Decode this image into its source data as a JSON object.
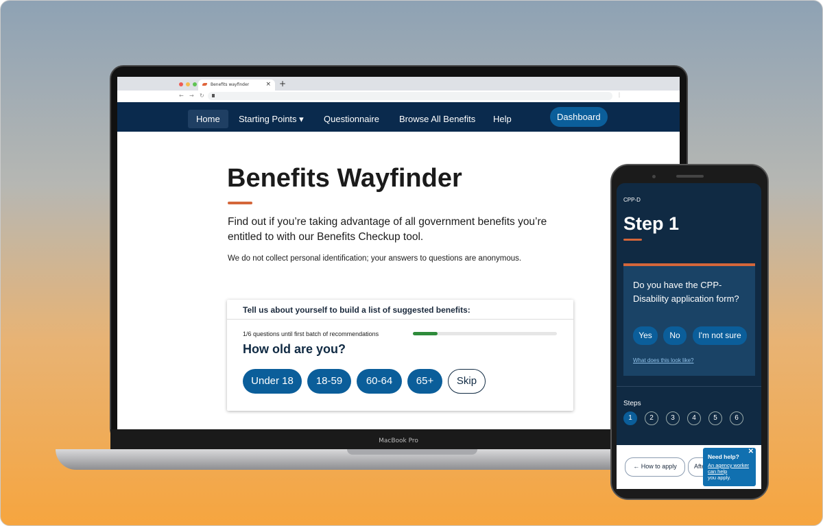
{
  "browser": {
    "tab_title": "Benefits wayfinder",
    "new_tab": "+",
    "close_tab": "×"
  },
  "nav": {
    "items": [
      "Home",
      "Starting Points",
      "Questionnaire",
      "Browse All Benefits",
      "Help"
    ],
    "dashboard": "Dashboard",
    "dropdown_caret": "▾"
  },
  "laptop_label": "MacBook Pro",
  "hero": {
    "title": "Benefits Wayfinder",
    "intro": "Find out if you’re taking advantage of all government benefits you’re entitled to with our Benefits Checkup tool.",
    "privacy": "We do not collect personal identification; your answers to questions are anonymous."
  },
  "card": {
    "header": "Tell us about yourself to build a list of suggested benefits:",
    "progress_text": "1/6 questions until first batch of recommendations",
    "progress": 0.17,
    "question": "How old are you?",
    "options": [
      "Under 18",
      "18-59",
      "60-64",
      "65+"
    ],
    "skip": "Skip"
  },
  "phone": {
    "eyebrow": "CPP-D",
    "title": "Step 1",
    "question": "Do you have the CPP-Disability application form?",
    "answers": [
      "Yes",
      "No",
      "I'm not sure"
    ],
    "help_link": "What does this look like?",
    "steps_label": "Steps",
    "steps": [
      "1",
      "2",
      "3",
      "4",
      "5",
      "6"
    ],
    "current_step": 1,
    "back_button": "How to apply",
    "next_button": "After",
    "help_title": "Need help?",
    "help_link_text": "An agency worker can help",
    "help_text": "you apply."
  },
  "colors": {
    "navy": "#0a2a4d",
    "accent": "#d4663a",
    "button": "#0b5e9a",
    "progress": "#2e8b3a"
  }
}
